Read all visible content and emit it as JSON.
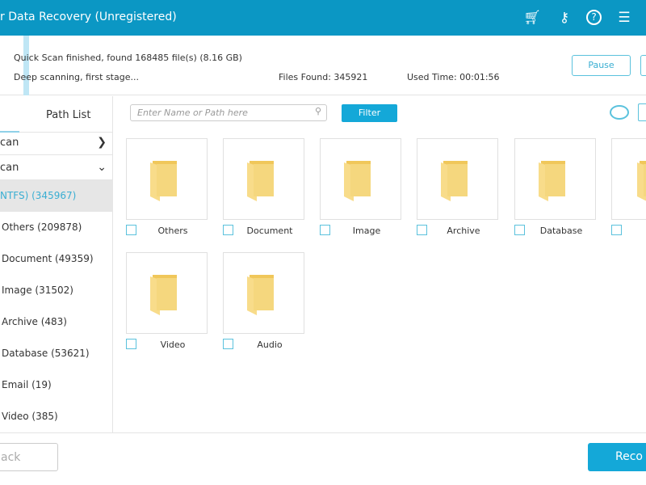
{
  "header": {
    "title": "r Data Recovery (Unregistered)",
    "icons": [
      "cart-icon",
      "key-icon",
      "help-icon",
      "menu-icon"
    ]
  },
  "status": {
    "quick_scan": "Quick Scan finished, found 168485 file(s) (8.16 GB)",
    "deep_scan": "Deep scanning, first stage...",
    "files_found": "Files Found: 345921",
    "used_time": "Used Time: 00:01:56",
    "pause_label": "Pause"
  },
  "sidebar": {
    "tab_label": "Path List",
    "sections": [
      {
        "label": "can",
        "expanded": false
      },
      {
        "label": "can",
        "expanded": true
      }
    ],
    "selected": "NTFS) (345967)",
    "items": [
      "Others (209878)",
      "Document (49359)",
      "Image (31502)",
      "Archive (483)",
      "Database (53621)",
      "Email (19)",
      "Video (385)"
    ]
  },
  "toolbar": {
    "search_placeholder": "Enter Name or Path here",
    "filter_label": "Filter"
  },
  "folders": [
    "Others",
    "Document",
    "Image",
    "Archive",
    "Database",
    "",
    "Video",
    "Audio"
  ],
  "footer": {
    "back_label": "ack",
    "recover_label": "Reco"
  },
  "colors": {
    "accent": "#0b97c4",
    "button": "#14a8d8",
    "folder": "#f5d77e"
  }
}
